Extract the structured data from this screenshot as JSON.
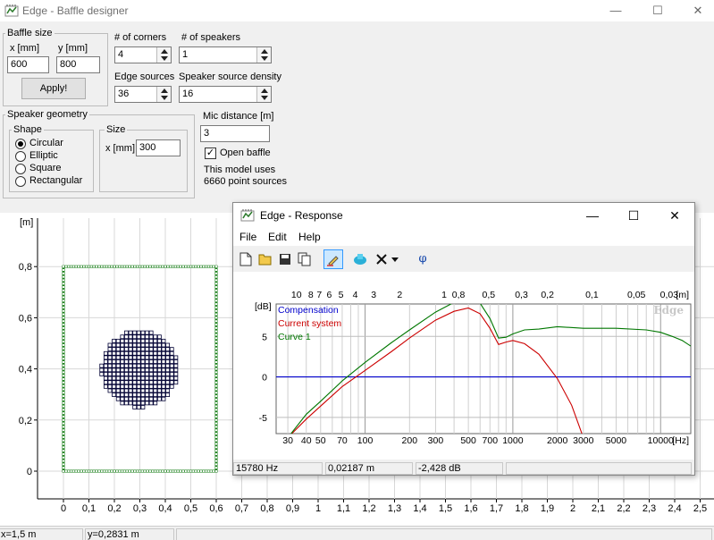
{
  "window": {
    "title": "Edge - Baffle designer",
    "controls": {
      "minimize": "—",
      "maximize": "☐",
      "close": "✕"
    }
  },
  "baffle_size": {
    "group_label": "Baffle size",
    "x_label": "x [mm]",
    "y_label": "y [mm]",
    "x_value": "600",
    "y_value": "800",
    "apply_label": "Apply!"
  },
  "corners": {
    "label": "# of corners",
    "value": "4"
  },
  "speakers": {
    "label": "# of speakers",
    "value": "1"
  },
  "edge_sources": {
    "label": "Edge sources",
    "value": "36"
  },
  "source_density": {
    "label": "Speaker source density",
    "value": "16"
  },
  "speaker_geometry": {
    "group_label": "Speaker geometry",
    "shape_label": "Shape",
    "shapes": [
      {
        "label": "Circular",
        "selected": true
      },
      {
        "label": "Elliptic",
        "selected": false
      },
      {
        "label": "Square",
        "selected": false
      },
      {
        "label": "Rectangular",
        "selected": false
      }
    ],
    "size_label": "Size",
    "size_x_label": "x [mm]",
    "size_x_value": "300"
  },
  "mic": {
    "label": "Mic distance [m]",
    "value": "3",
    "open_baffle_label": "Open baffle",
    "open_baffle_checked": true,
    "model_note_1": "This model uses",
    "model_note_2": "6660 point sources"
  },
  "baffle_plot": {
    "unit_label": "[m]",
    "y_ticks": [
      "0,8",
      "0,6",
      "0,4",
      "0,2",
      "0"
    ],
    "x_ticks": [
      "0",
      "0,1",
      "0,2",
      "0,3",
      "0,4",
      "0,5",
      "0,6",
      "0,7",
      "0,8",
      "0,9",
      "1",
      "1,1",
      "1,2",
      "1,3",
      "1,4",
      "1,5",
      "1,6",
      "1,7",
      "1,8",
      "1,9",
      "2",
      "2,1",
      "2,2",
      "2,3",
      "2,4",
      "2,5"
    ],
    "baffle_color": "#1a7f1a",
    "speaker_color": "#000033"
  },
  "status": {
    "x_readout": "x=1,5 m",
    "y_readout": "y=0,2831 m"
  },
  "response": {
    "title": "Edge - Response",
    "menu": [
      "File",
      "Edit",
      "Help"
    ],
    "toolbar_icons": [
      "new-icon",
      "open-icon",
      "save-icon",
      "copy-icon",
      "pencil-icon",
      "overlay-icon",
      "delete-icon",
      "dropdown-icon",
      "phase-icon"
    ],
    "phase_glyph": "φ",
    "db_label": "[dB]",
    "wavelength_label": "[m]",
    "hz_label": "[Hz]",
    "watermark": "Edge",
    "legend": [
      {
        "name": "Compensation",
        "color": "#0000cc"
      },
      {
        "name": "Current system",
        "color": "#cc0000"
      },
      {
        "name": "Curve 1",
        "color": "#007700"
      }
    ],
    "freq_ticks": [
      "30",
      "40",
      "50",
      "70",
      "100",
      "200",
      "300",
      "500",
      "700",
      "1000",
      "2000",
      "3000",
      "5000",
      "10000"
    ],
    "wavelength_ticks": [
      "10",
      "8",
      "7",
      "6",
      "5",
      "4",
      "3",
      "2",
      "1",
      "0,8",
      "0,5",
      "0,3",
      "0,2",
      "0,1",
      "0,05",
      "0,03"
    ],
    "db_ticks": [
      "5",
      "0",
      "-5"
    ],
    "status_freq": "15780 Hz",
    "status_wavelength": "0,02187 m",
    "status_db": "-2,428 dB"
  },
  "chart_data": {
    "type": "line",
    "xlabel": "[Hz]",
    "ylabel": "[dB]",
    "xscale": "log",
    "xlim": [
      25,
      16000
    ],
    "ylim": [
      -7,
      9
    ],
    "grid": true,
    "legend_position": "top-left",
    "series": [
      {
        "name": "Compensation",
        "x": [
          25,
          16000
        ],
        "y": [
          0,
          0
        ]
      },
      {
        "name": "Current system",
        "x": [
          30,
          40,
          50,
          70,
          100,
          150,
          200,
          300,
          400,
          500,
          600,
          700,
          800,
          900,
          1000,
          1200,
          1500,
          2000,
          2500,
          3000
        ],
        "y": [
          -7.5,
          -5.2,
          -3.6,
          -1.2,
          0.8,
          3.1,
          4.8,
          7.0,
          8.1,
          8.5,
          7.8,
          6.0,
          4.0,
          4.3,
          4.5,
          4.1,
          2.8,
          -0.2,
          -3.5,
          -7.5
        ]
      },
      {
        "name": "Curve 1",
        "x": [
          30,
          40,
          50,
          70,
          100,
          150,
          200,
          300,
          400,
          500,
          600,
          700,
          800,
          900,
          1000,
          1200,
          1500,
          2000,
          3000,
          5000,
          8000,
          10000,
          12000,
          14000,
          16000
        ],
        "y": [
          -7.5,
          -4.6,
          -3.0,
          -0.5,
          1.8,
          4.2,
          5.8,
          8.0,
          9.2,
          9.6,
          9.1,
          7.2,
          4.8,
          4.9,
          5.3,
          5.8,
          5.9,
          6.2,
          6.0,
          6.0,
          5.8,
          5.5,
          5.0,
          4.5,
          3.8
        ]
      }
    ]
  }
}
